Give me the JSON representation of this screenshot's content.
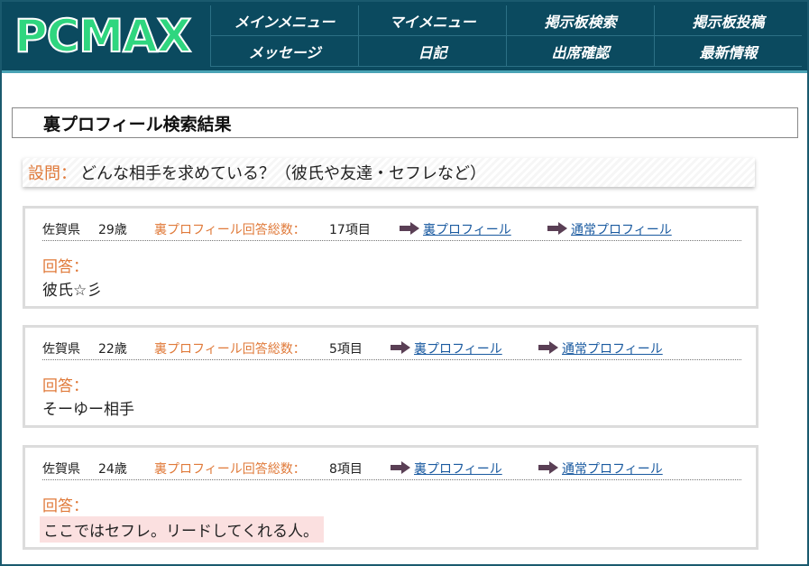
{
  "logo": "PCMAX",
  "nav": [
    "メインメニュー",
    "マイメニュー",
    "掲示板検索",
    "掲示板投稿",
    "メッセージ",
    "日記",
    "出席確認",
    "最新情報"
  ],
  "page_title": "裏プロフィール検索結果",
  "question": {
    "label": "設問：",
    "text": "どんな相手を求めている？（彼氏や友達・セフレなど）"
  },
  "results": [
    {
      "pref": "佐賀県",
      "age": "29歳",
      "count_label": "裏プロフィール回答総数：",
      "count": "17項目",
      "link_ura": "裏プロフィール",
      "link_normal": "通常プロフィール",
      "answer_label": "回答：",
      "answer": "彼氏☆彡"
    },
    {
      "pref": "佐賀県",
      "age": "22歳",
      "count_label": "裏プロフィール回答総数：",
      "count": "5項目",
      "link_ura": "裏プロフィール",
      "link_normal": "通常プロフィール",
      "answer_label": "回答：",
      "answer": "そーゆー相手"
    },
    {
      "pref": "佐賀県",
      "age": "24歳",
      "count_label": "裏プロフィール回答総数：",
      "count": "8項目",
      "link_ura": "裏プロフィール",
      "link_normal": "通常プロフィール",
      "answer_label": "回答：",
      "answer": "ここではセフレ。リードしてくれる人。"
    }
  ],
  "colors": {
    "header_bg": "#0b4a5f",
    "logo": "#2fd67f",
    "accent": "#e07a3a",
    "link": "#1a5aa0",
    "arrow": "#5a3f55",
    "highlight": "#fbe0e0"
  },
  "icons": {
    "link_arrow": "arrow-right-icon"
  }
}
